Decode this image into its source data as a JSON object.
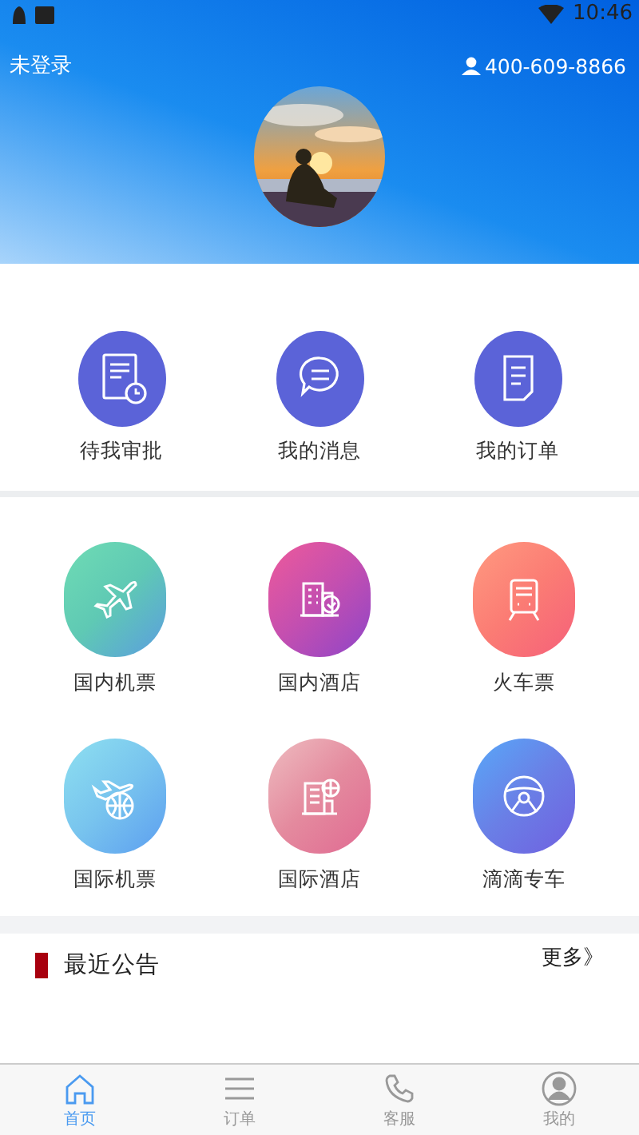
{
  "status_bar": {
    "time": "10:46"
  },
  "header": {
    "login_status": "未登录",
    "phone": "400-609-8866"
  },
  "quick_actions": [
    {
      "label": "待我审批",
      "kind": "approval"
    },
    {
      "label": "我的消息",
      "kind": "message"
    },
    {
      "label": "我的订单",
      "kind": "order"
    }
  ],
  "services": [
    {
      "label": "国内机票",
      "kind": "plane",
      "color": "#5fc9b4"
    },
    {
      "label": "国内酒店",
      "kind": "hotel",
      "color": "#c44fb0"
    },
    {
      "label": "火车票",
      "kind": "train",
      "color": "#fb7c74"
    },
    {
      "label": "国际机票",
      "kind": "intl-plane",
      "color": "#78c4ee"
    },
    {
      "label": "国际酒店",
      "kind": "intl-hotel",
      "color": "#e48a9e"
    },
    {
      "label": "滴滴专车",
      "kind": "car",
      "color": "#6a7fe6"
    }
  ],
  "announcements": {
    "title": "最近公告",
    "more": "更多》"
  },
  "tab_bar": [
    {
      "label": "首页",
      "kind": "home",
      "selected": true
    },
    {
      "label": "订单",
      "kind": "list",
      "selected": false
    },
    {
      "label": "客服",
      "kind": "phone",
      "selected": false
    },
    {
      "label": "我的",
      "kind": "user",
      "selected": false
    }
  ]
}
